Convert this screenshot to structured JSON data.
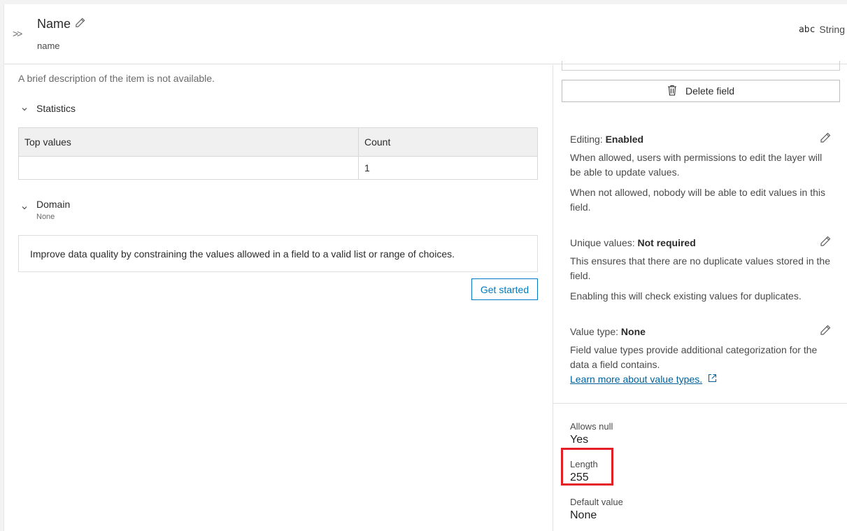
{
  "header": {
    "title": "Name",
    "subtitle": "name",
    "type_icon": "abc",
    "type_label": "String"
  },
  "left": {
    "description": "A brief description of the item is not available.",
    "statistics": {
      "title": "Statistics",
      "columns": [
        "Top values",
        "Count"
      ],
      "rows": [
        [
          "",
          "1"
        ]
      ]
    },
    "domain": {
      "title": "Domain",
      "subtitle": "None",
      "message": "Improve data quality by constraining the values allowed in a field to a valid list or range of choices.",
      "button_label": "Get started"
    }
  },
  "right": {
    "delete_label": "Delete field",
    "editing": {
      "label": "Editing:",
      "value": "Enabled",
      "p1": "When allowed, users with permissions to edit the layer will be able to update values.",
      "p2": "When not allowed, nobody will be able to edit values in this field."
    },
    "unique": {
      "label": "Unique values:",
      "value": "Not required",
      "p1": "This ensures that there are no duplicate values stored in the field.",
      "p2": "Enabling this will check existing values for duplicates."
    },
    "value_type": {
      "label": "Value type:",
      "value": "None",
      "p1": "Field value types provide additional categorization for the data a field contains.",
      "link": "Learn more about value types."
    },
    "properties": {
      "allows_null_label": "Allows null",
      "allows_null_value": "Yes",
      "length_label": "Length",
      "length_value": "255",
      "default_label": "Default value",
      "default_value": "None"
    }
  },
  "colors": {
    "accent": "#007ac2",
    "link": "#00619b",
    "highlight": "#e41e26"
  }
}
